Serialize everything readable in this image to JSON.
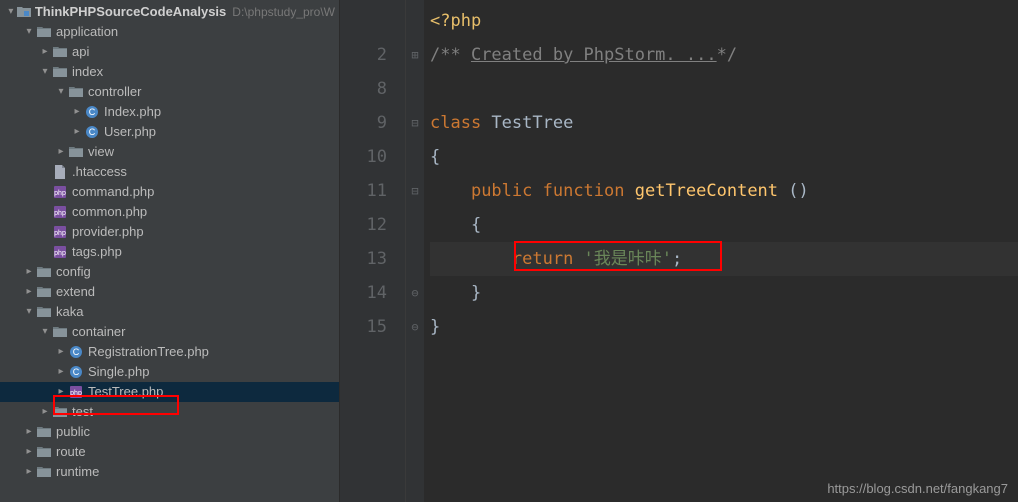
{
  "project": {
    "root": {
      "name": "ThinkPHPSourceCodeAnalysis",
      "path": "D:\\phpstudy_pro\\W"
    },
    "tree": [
      {
        "depth": 0,
        "arrow": "down",
        "icon": "module",
        "label": "ThinkPHPSourceCodeAnalysis",
        "root": true
      },
      {
        "depth": 1,
        "arrow": "down",
        "icon": "folder",
        "label": "application"
      },
      {
        "depth": 2,
        "arrow": "right",
        "icon": "folder",
        "label": "api"
      },
      {
        "depth": 2,
        "arrow": "down",
        "icon": "folder",
        "label": "index"
      },
      {
        "depth": 3,
        "arrow": "down",
        "icon": "folder",
        "label": "controller"
      },
      {
        "depth": 4,
        "arrow": "right",
        "icon": "phpclass",
        "label": "Index.php"
      },
      {
        "depth": 4,
        "arrow": "right",
        "icon": "phpclass",
        "label": "User.php"
      },
      {
        "depth": 3,
        "arrow": "right",
        "icon": "folder",
        "label": "view"
      },
      {
        "depth": 2,
        "arrow": "none",
        "icon": "file",
        "label": ".htaccess"
      },
      {
        "depth": 2,
        "arrow": "none",
        "icon": "phpfile",
        "label": "command.php"
      },
      {
        "depth": 2,
        "arrow": "none",
        "icon": "phpfile",
        "label": "common.php"
      },
      {
        "depth": 2,
        "arrow": "none",
        "icon": "phpfile",
        "label": "provider.php"
      },
      {
        "depth": 2,
        "arrow": "none",
        "icon": "phpfile",
        "label": "tags.php"
      },
      {
        "depth": 1,
        "arrow": "right",
        "icon": "folder",
        "label": "config"
      },
      {
        "depth": 1,
        "arrow": "right",
        "icon": "folder",
        "label": "extend"
      },
      {
        "depth": 1,
        "arrow": "down",
        "icon": "folder",
        "label": "kaka"
      },
      {
        "depth": 2,
        "arrow": "down",
        "icon": "folder",
        "label": "container"
      },
      {
        "depth": 3,
        "arrow": "right",
        "icon": "phpclass",
        "label": "RegistrationTree.php"
      },
      {
        "depth": 3,
        "arrow": "right",
        "icon": "phpclass",
        "label": "Single.php"
      },
      {
        "depth": 3,
        "arrow": "right",
        "icon": "phpfile",
        "label": "TestTree.php",
        "selected": true,
        "redbox": true
      },
      {
        "depth": 2,
        "arrow": "right",
        "icon": "folder",
        "label": "test"
      },
      {
        "depth": 1,
        "arrow": "right",
        "icon": "folder",
        "label": "public"
      },
      {
        "depth": 1,
        "arrow": "right",
        "icon": "folder",
        "label": "route"
      },
      {
        "depth": 1,
        "arrow": "right",
        "icon": "folder",
        "label": "runtime"
      }
    ]
  },
  "editor": {
    "gutter": [
      "",
      "2",
      "8",
      "9",
      "10",
      "11",
      "12",
      "13",
      "14",
      "15"
    ],
    "fold": [
      "",
      "⊞",
      "",
      "⊟",
      "",
      "⊟",
      "",
      "",
      "⊖",
      "⊖"
    ],
    "code": {
      "l1_tag": "<?php",
      "l2_a": "/** ",
      "l2_b": "Created by PhpStorm. ...",
      "l2_c": "*/",
      "l4_kw": "class ",
      "l4_name": "TestTree",
      "l5_brace": "{",
      "l6_pub": "public ",
      "l6_fn": "function ",
      "l6_name": "getTreeContent ",
      "l6_par": "()",
      "l7_brace": "{",
      "l8_ret": "return ",
      "l8_str": "'我是咔咔'",
      "l8_semi": ";",
      "l9_brace": "}",
      "l10_brace": "}"
    },
    "highlight_line_index": 7
  },
  "watermark": "https://blog.csdn.net/fangkang7"
}
